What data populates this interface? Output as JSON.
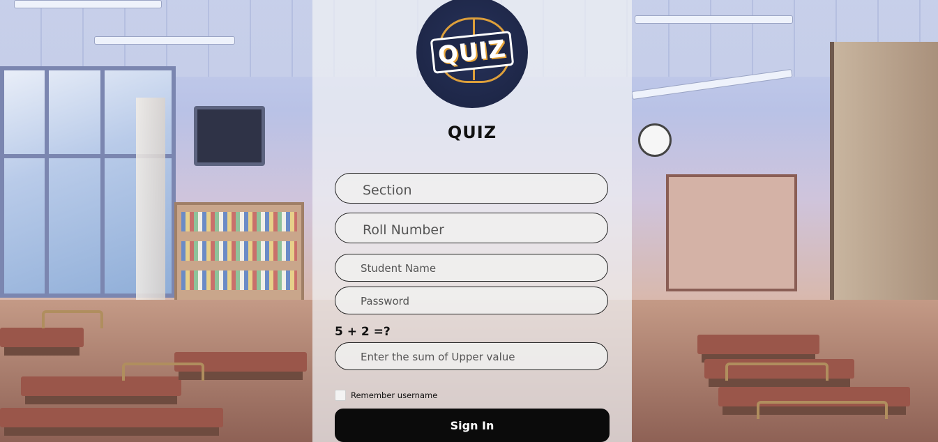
{
  "logo": {
    "text": "QUIZ",
    "brain_color": "#e8a63a",
    "bg_color": "#1e2748"
  },
  "title": "QUIZ",
  "form": {
    "section_placeholder": "Section",
    "roll_placeholder": "Roll Number",
    "name_placeholder": "Student Name",
    "password_placeholder": "Password",
    "captcha_question": "5 + 2 =?",
    "captcha_placeholder": "Enter the sum of Upper value",
    "remember_label": "Remember username",
    "remember_checked": false,
    "signin_label": "Sign In"
  },
  "colors": {
    "panel_overlay": "rgba(240,241,244,0.72)",
    "button_bg": "#0b0b0b",
    "button_text": "#ffffff"
  }
}
